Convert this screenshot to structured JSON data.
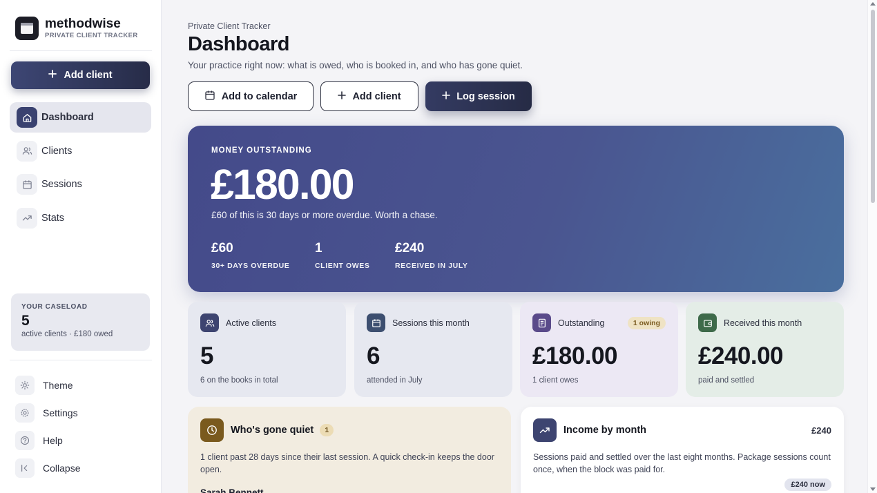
{
  "brand": {
    "name": "methodwise",
    "subtitle": "PRIVATE CLIENT TRACKER"
  },
  "sidebar": {
    "add_client_label": "Add client",
    "items": [
      {
        "label": "Dashboard",
        "icon": "home-icon",
        "active": true
      },
      {
        "label": "Clients",
        "icon": "users-icon"
      },
      {
        "label": "Sessions",
        "icon": "calendar-icon"
      },
      {
        "label": "Stats",
        "icon": "trend-icon"
      }
    ],
    "caseload": {
      "title": "YOUR CASELOAD",
      "count": "5",
      "sub": "active clients · £180 owed"
    },
    "bottom_items": [
      {
        "label": "Theme",
        "icon": "sun-icon"
      },
      {
        "label": "Settings",
        "icon": "gear-icon"
      },
      {
        "label": "Help",
        "icon": "help-icon"
      },
      {
        "label": "Collapse",
        "icon": "collapse-icon"
      }
    ]
  },
  "header": {
    "breadcrumb": "Private Client Tracker",
    "title": "Dashboard",
    "subtitle": "Your practice right now: what is owed, who is booked in, and who has gone quiet.",
    "actions": {
      "calendar": "Add to calendar",
      "add_client": "Add client",
      "log_session": "Log session"
    }
  },
  "hero": {
    "label": "MONEY OUTSTANDING",
    "amount": "£180.00",
    "note": "£60 of this is 30 days or more overdue. Worth a chase.",
    "stats": [
      {
        "value": "£60",
        "label": "30+ DAYS OVERDUE"
      },
      {
        "value": "1",
        "label": "CLIENT OWES"
      },
      {
        "value": "£240",
        "label": "RECEIVED IN JULY"
      }
    ]
  },
  "cards": [
    {
      "label": "Active clients",
      "value": "5",
      "sub": "6 on the books in total",
      "icon": "users-icon"
    },
    {
      "label": "Sessions this month",
      "value": "6",
      "sub": "attended in July",
      "icon": "calendar-icon"
    },
    {
      "label": "Outstanding",
      "value": "£180.00",
      "sub": "1 client owes",
      "badge": "1 owing",
      "icon": "invoice-icon"
    },
    {
      "label": "Received this month",
      "value": "£240.00",
      "sub": "paid and settled",
      "icon": "wallet-icon"
    }
  ],
  "quiet": {
    "title": "Who's gone quiet",
    "count": "1",
    "desc": "1 client past 28 days since their last session. A quick check-in keeps the door open.",
    "first_name": "Sarah Bennett"
  },
  "income": {
    "title": "Income by month",
    "total": "£240",
    "desc": "Sessions paid and settled over the last eight months. Package sessions count once, when the block was paid for.",
    "now_badge": "£240 now"
  },
  "colors": {
    "accent": "#3a4270",
    "hero_start": "#444a8a",
    "hero_end": "#4a6f9e",
    "card_blue": "#e6e8f0",
    "card_purple": "#ece8f4",
    "card_green": "#e4ede7",
    "panel_quiet": "#f2ece0"
  }
}
